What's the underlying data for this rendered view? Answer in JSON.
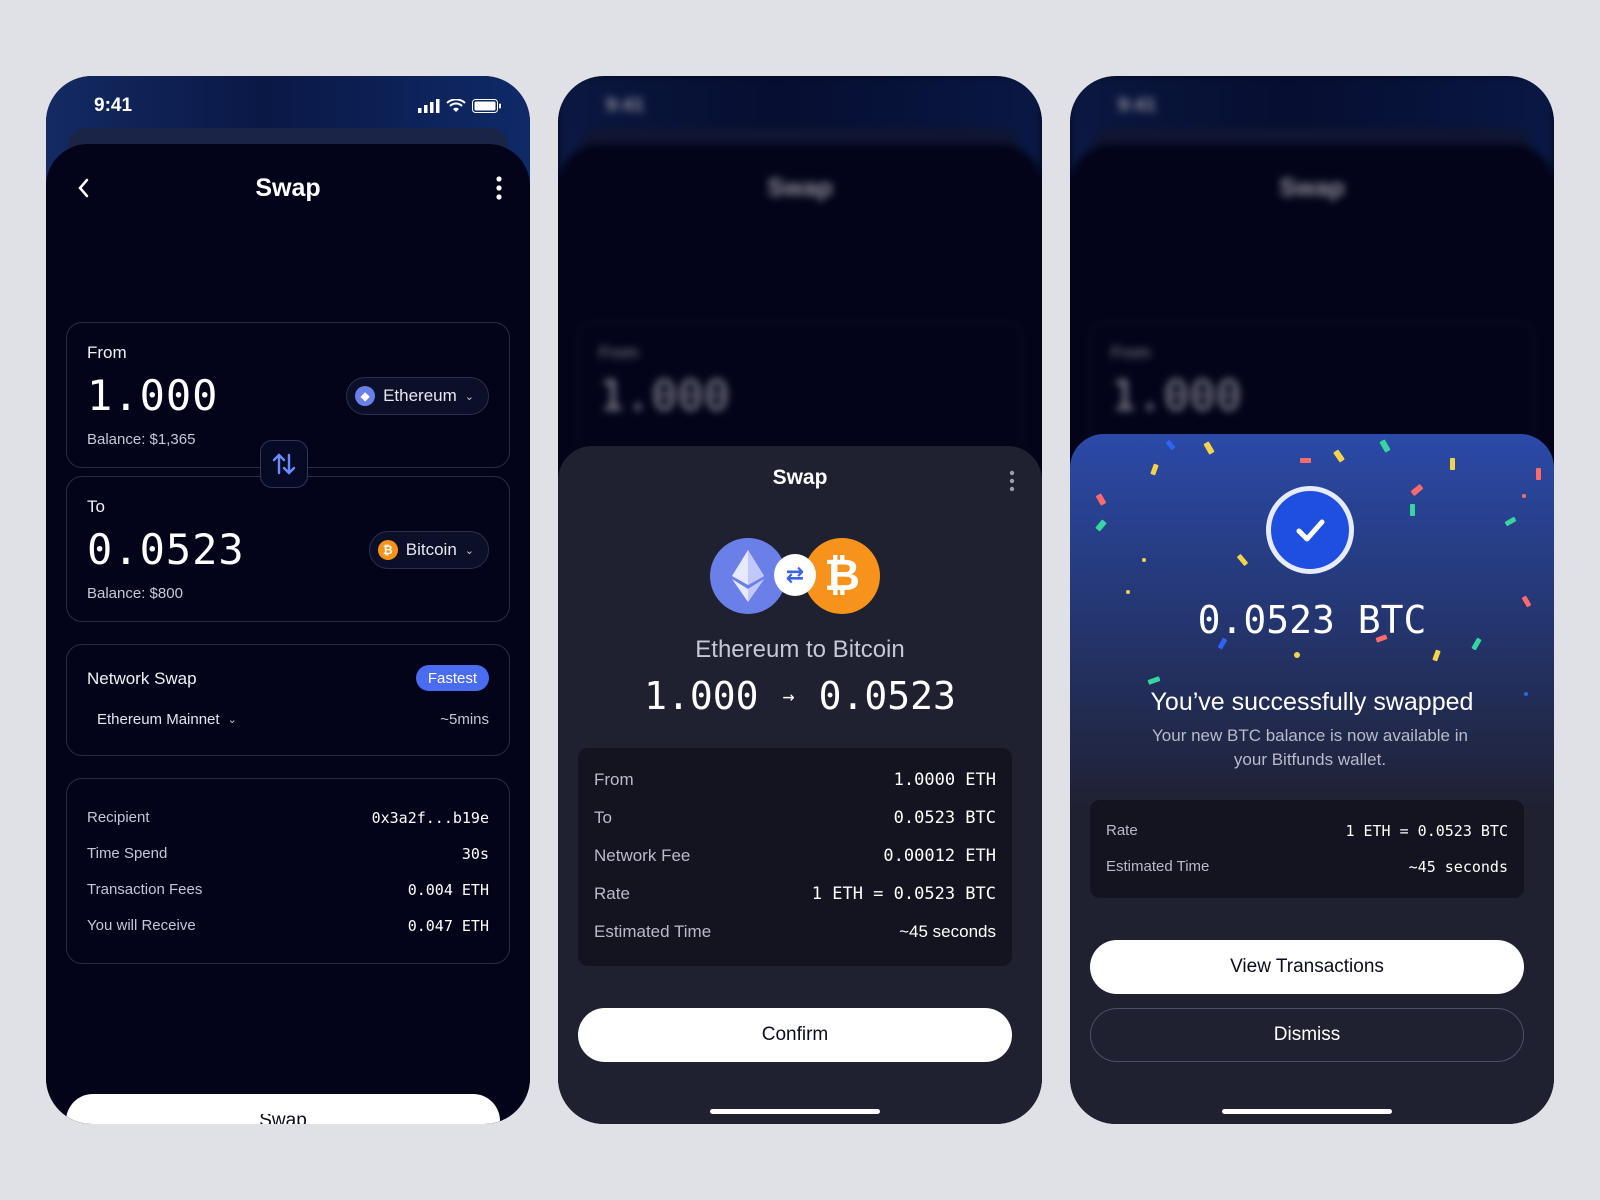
{
  "status": {
    "time": "9:41"
  },
  "swap_screen": {
    "title": "Swap",
    "from": {
      "label": "From",
      "amount": "1.000",
      "balance": "Balance: $1,365",
      "token": "Ethereum"
    },
    "to": {
      "label": "To",
      "amount": "0.0523",
      "balance": "Balance: $800",
      "token": "Bitcoin"
    },
    "network": {
      "label": "Network Swap",
      "badge": "Fastest",
      "network_name": "Ethereum Mainnet",
      "eta": "~5mins"
    },
    "details": [
      {
        "key": "Recipient",
        "value": "0x3a2f...b19e"
      },
      {
        "key": "Time Spend",
        "value": "30s"
      },
      {
        "key": "Transaction Fees",
        "value": "0.004 ETH"
      },
      {
        "key": "You will Receive",
        "value": "0.047 ETH"
      }
    ],
    "button": "Swap"
  },
  "confirm_modal": {
    "title": "Swap",
    "subtitle": "Ethereum to Bitcoin",
    "from_amount": "1.000",
    "to_amount": "0.0523",
    "rows": [
      {
        "key": "From",
        "value": "1.0000 ETH"
      },
      {
        "key": "To",
        "value": "0.0523 BTC"
      },
      {
        "key": "Network Fee",
        "value": "0.00012 ETH"
      },
      {
        "key": "Rate",
        "value": "1 ETH = 0.0523 BTC"
      },
      {
        "key": "Estimated Time",
        "value": "~45 seconds"
      }
    ],
    "button": "Confirm"
  },
  "success_modal": {
    "amount": "0.0523 BTC",
    "title": "You’ve successfully swapped",
    "description": "Your new BTC balance is now available in your Bitfunds wallet.",
    "rows": [
      {
        "key": "Rate",
        "value": "1 ETH = 0.0523 BTC"
      },
      {
        "key": "Estimated Time",
        "value": "~45 seconds"
      }
    ],
    "primary_button": "View Transactions",
    "secondary_button": "Dismiss"
  },
  "icons": [
    "back-icon",
    "more-icon",
    "ethereum-icon",
    "bitcoin-icon",
    "swap-arrows-icon",
    "chevron-down-icon",
    "checkmark-icon",
    "signal-icon",
    "wifi-icon",
    "battery-icon"
  ],
  "colors": {
    "accent": "#4a6cf0",
    "eth": "#6b7fe8",
    "btc": "#f7931a",
    "background": "#03041a",
    "modal": "#1f2030"
  }
}
